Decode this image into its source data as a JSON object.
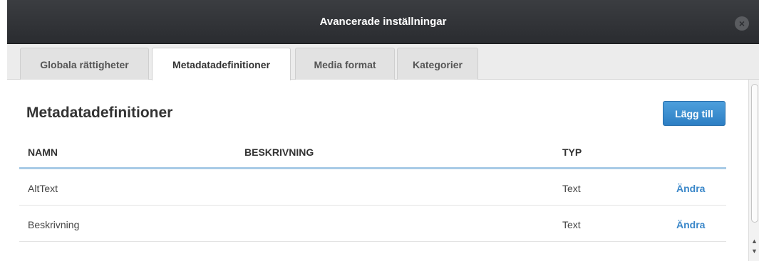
{
  "dialog": {
    "title": "Avancerade inställningar",
    "close_glyph": "×"
  },
  "tabs": [
    {
      "label": "Globala rättigheter",
      "active": false
    },
    {
      "label": "Metadatadefinitioner",
      "active": true
    },
    {
      "label": "Media format",
      "active": false
    },
    {
      "label": "Kategorier",
      "active": false
    }
  ],
  "main": {
    "title": "Metadatadefinitioner",
    "add_label": "Lägg till",
    "accent_color": "#3a87c9"
  },
  "table": {
    "headers": [
      "NAMN",
      "BESKRIVNING",
      "TYP"
    ],
    "rows": [
      {
        "name": "AltText",
        "description": "",
        "type": "Text",
        "action": "Ändra"
      },
      {
        "name": "Beskrivning",
        "description": "",
        "type": "Text",
        "action": "Ändra"
      }
    ]
  },
  "scrollbar": {
    "up_glyph": "▲",
    "down_glyph": "▼"
  }
}
